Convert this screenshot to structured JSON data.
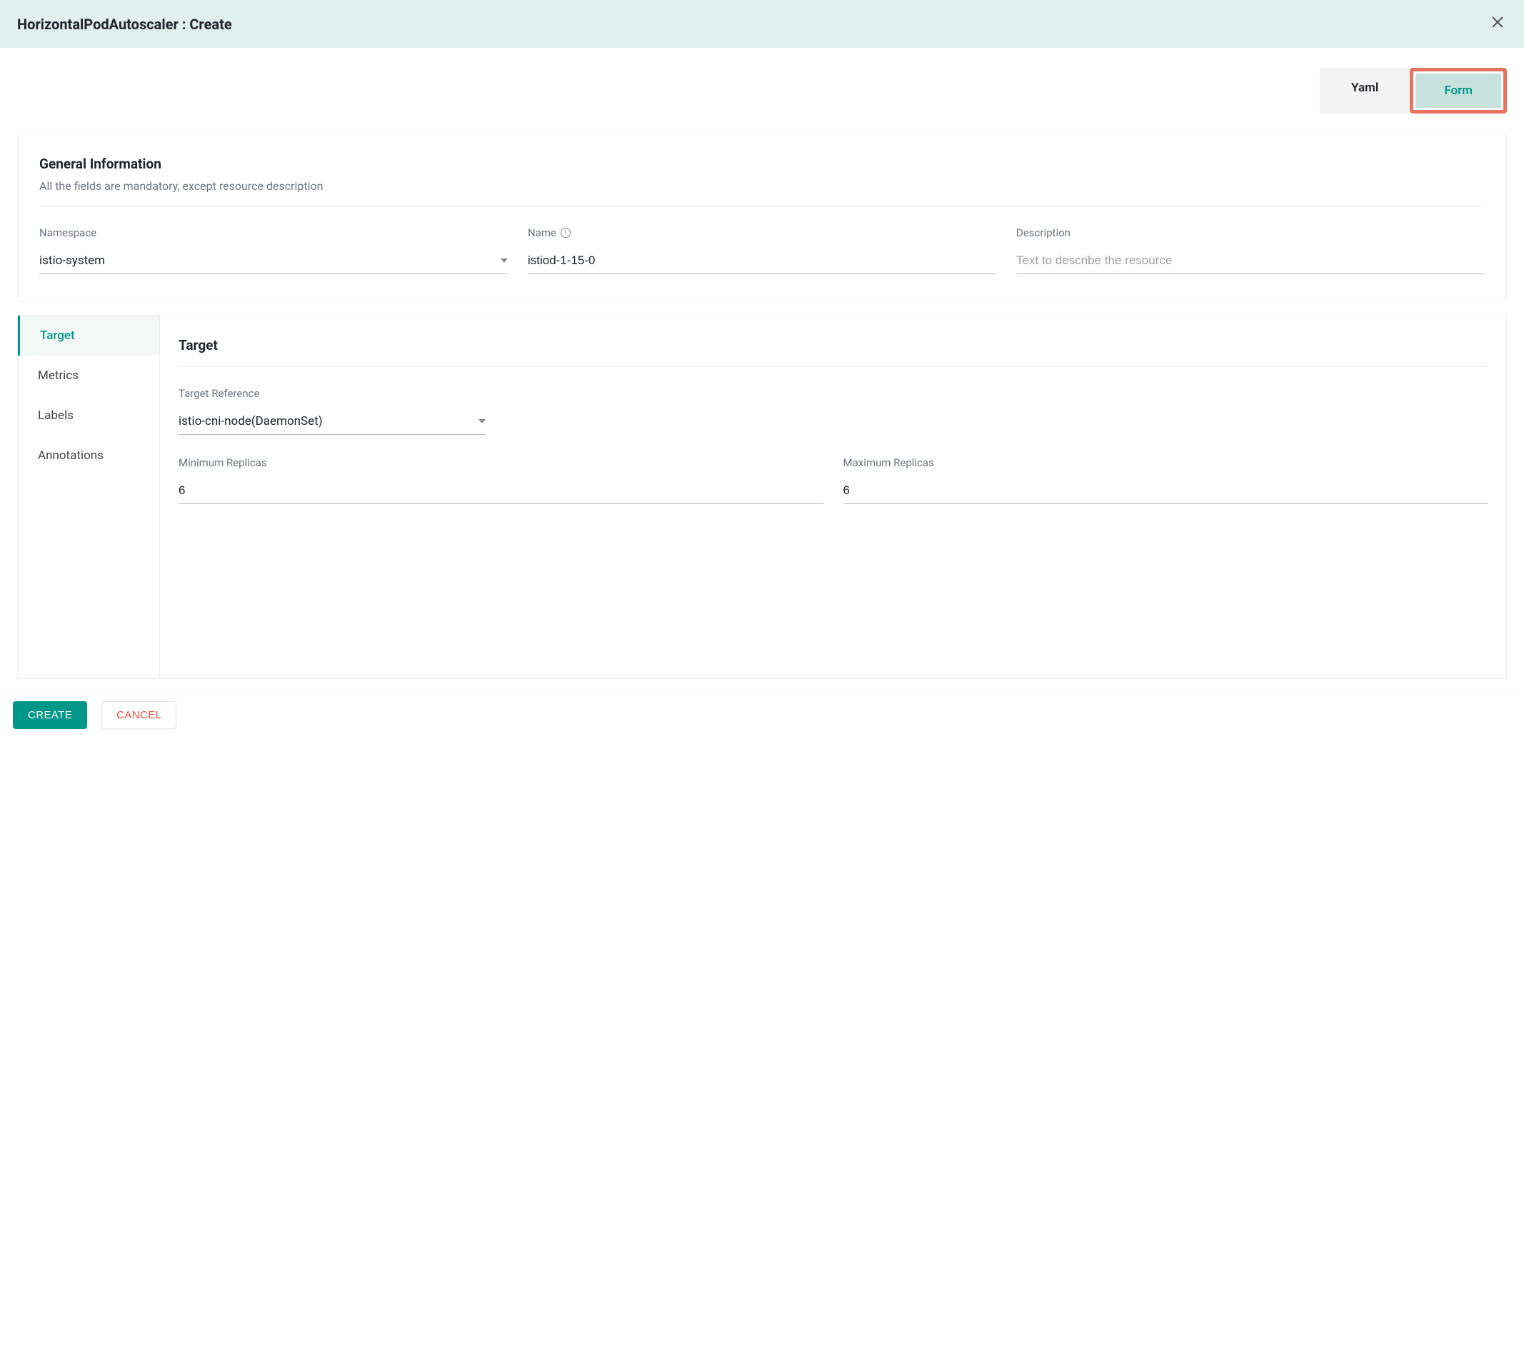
{
  "header": {
    "title": "HorizontalPodAutoscaler : Create"
  },
  "viewTabs": {
    "yaml": "Yaml",
    "form": "Form"
  },
  "general": {
    "title": "General Information",
    "description": "All the fields are mandatory, except resource description",
    "namespace": {
      "label": "Namespace",
      "value": "istio-system"
    },
    "name": {
      "label": "Name",
      "value": "istiod-1-15-0"
    },
    "desc": {
      "label": "Description",
      "placeholder": "Text to describe the resource",
      "value": ""
    }
  },
  "sidenav": {
    "items": [
      {
        "label": "Target"
      },
      {
        "label": "Metrics"
      },
      {
        "label": "Labels"
      },
      {
        "label": "Annotations"
      }
    ]
  },
  "target": {
    "title": "Target",
    "reference": {
      "label": "Target Reference",
      "value": "istio-cni-node(DaemonSet)"
    },
    "minReplicas": {
      "label": "Minimum Replicas",
      "value": "6"
    },
    "maxReplicas": {
      "label": "Maximum Replicas",
      "value": "6"
    }
  },
  "footer": {
    "create": "CREATE",
    "cancel": "CANCEL"
  }
}
